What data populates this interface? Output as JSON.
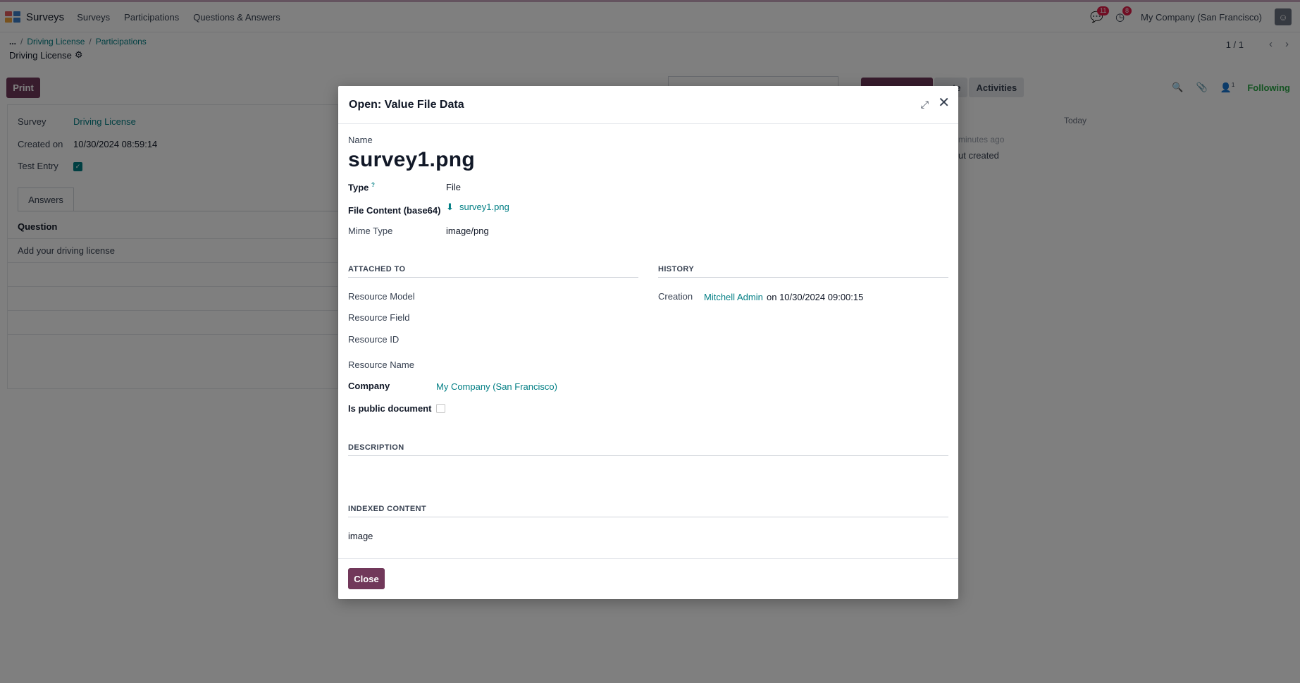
{
  "topbar": {
    "app_name": "Surveys",
    "menu": [
      "Surveys",
      "Participations",
      "Questions & Answers"
    ],
    "messages_badge": "11",
    "activities_badge": "8",
    "company": "My Company (San Francisco)"
  },
  "control_panel": {
    "breadcrumb": [
      "...",
      "Driving License",
      "Participations"
    ],
    "record_title": "Driving License",
    "pager": "1 / 1"
  },
  "form": {
    "print_label": "Print",
    "survey_label": "Survey",
    "survey_value": "Driving License",
    "created_label": "Created on",
    "created_value": "10/30/2024 08:59:14",
    "test_entry_label": "Test Entry",
    "test_entry_checked": true,
    "tab_answers": "Answers",
    "question_header": "Question",
    "question_row": "Add your driving license"
  },
  "chatter": {
    "note_label": "note",
    "activities_label": "Activities",
    "followers_count": "1",
    "following_label": "Following",
    "today_label": "Today",
    "msg_time": "minutes ago",
    "msg_text": "ut created"
  },
  "modal": {
    "title": "Open: Value File Data",
    "name_label": "Name",
    "name_value": "survey1.png",
    "type_label": "Type",
    "type_help": "?",
    "type_value": "File",
    "file_content_label": "File Content (base64)",
    "file_content_value": "survey1.png",
    "mime_label": "Mime Type",
    "mime_value": "image/png",
    "attached_section": "ATTACHED TO",
    "history_section": "HISTORY",
    "res_model_label": "Resource Model",
    "res_field_label": "Resource Field",
    "res_id_label": "Resource ID",
    "res_name_label": "Resource Name",
    "company_label": "Company",
    "company_value": "My Company (San Francisco)",
    "public_label": "Is public document",
    "public_checked": false,
    "creation_label": "Creation",
    "creation_user": "Mitchell Admin",
    "creation_on": "on 10/30/2024 09:00:15",
    "description_section": "DESCRIPTION",
    "indexed_section": "INDEXED CONTENT",
    "indexed_value": "image",
    "close_label": "Close"
  }
}
